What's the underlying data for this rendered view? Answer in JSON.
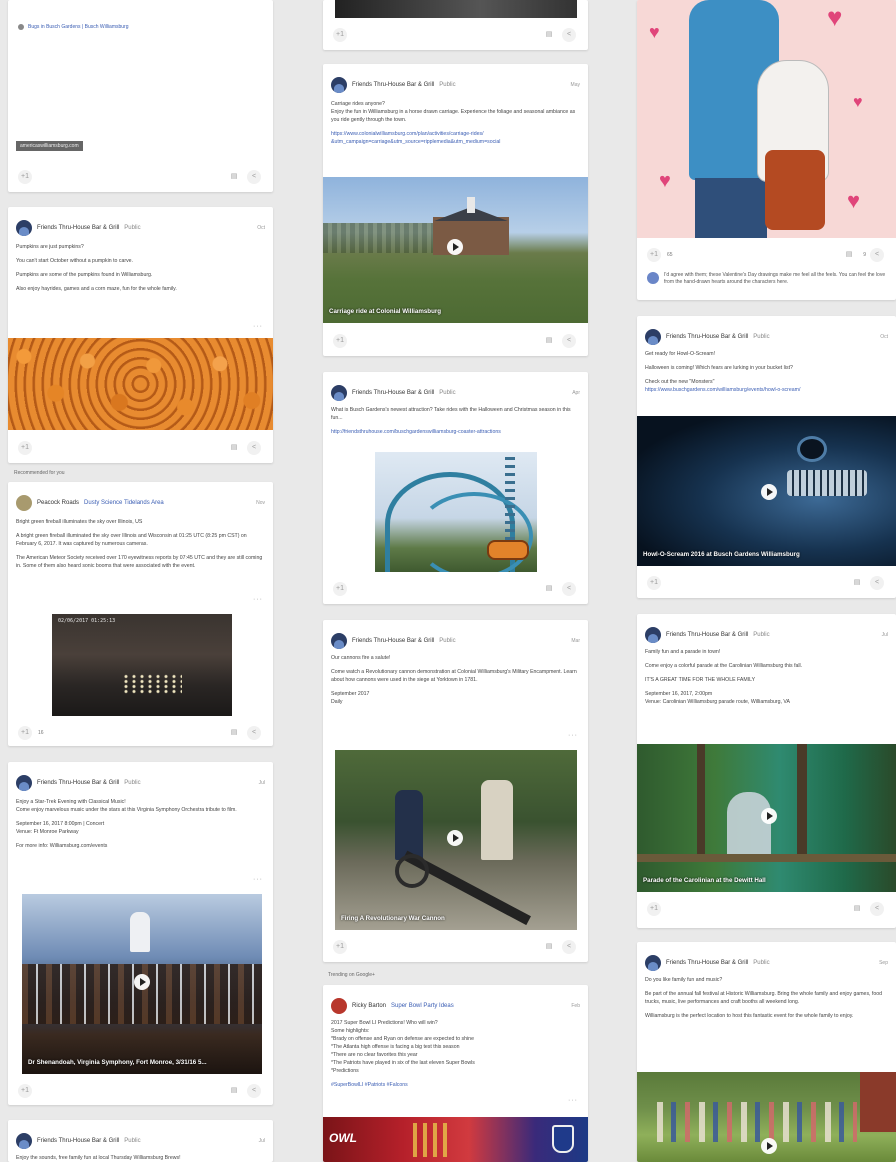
{
  "col1": {
    "card_a": {
      "link_text": "Bugs in Busch Gardens | Busch Williamsburg",
      "badge": "americaswilliamsburg.com"
    },
    "card_pumpkins": {
      "author": "Friends Thru-House Bar & Grill",
      "visibility": "Public",
      "time": "Oct",
      "p1": "Pumpkins are just pumpkins?",
      "p2": "You can't start October without a pumpkin to carve.",
      "p3": "Pumpkins are some of the pumpkins found in Williamsburg.",
      "p4": "Also enjoy hayrides, games and a corn maze, fun for the whole family."
    },
    "section_label": "Recommended for you",
    "card_fireball": {
      "author": "Peacock Roads",
      "group": "Dusty Science Tidelands Area",
      "time": "Nov",
      "p1": "Bright green fireball illuminates the sky over Illinois, US",
      "p2": "A bright green fireball illuminated the sky over Illinois and Wisconsin at 01:25 UTC (8:25 pm CST) on February 6, 2017. It was captured by numerous cameras.",
      "p3": "The American Meteor Society received over 170 eyewitness reports by 07:45 UTC and they are still coming in. Some of them also heard sonic booms that were associated with the event.",
      "timestamp": "02/06/2017  01:25:13",
      "plus_count": "16"
    },
    "card_symphony": {
      "author": "Friends Thru-House Bar & Grill",
      "visibility": "Public",
      "time": "Jul",
      "p1": "Enjoy a Star-Trek Evening with Classical Music!",
      "p2": "Come enjoy marvelous music under the stars at this Virginia Symphony Orchestra tribute to film.",
      "p3": "September 16, 2017 8:00pm | Concert",
      "p4": "Venue: Ft Monroe Parkway",
      "p5": "For more info: Williamsburg.com/events",
      "caption": "Dr Shenandoah, Virginia Symphony, Fort Monroe, 3/31/16 5..."
    },
    "card_bottom": {
      "author": "Friends Thru-House Bar & Grill",
      "visibility": "Public",
      "time": "Jul",
      "p1": "Enjoy the sounds, free family fun at local Thursday Williamsburg Brews!"
    }
  },
  "col2": {
    "card_carriage": {
      "author": "Friends Thru-House Bar & Grill",
      "visibility": "Public",
      "time": "May",
      "p1": "Carriage rides anyone?",
      "p2": "Enjoy the fun in Williamsburg in a horse drawn carriage. Experience the foliage and seasonal ambiance as you ride gently through the town.",
      "link": "https://www.colonialwilliamsburg.com/plan/activities/carriage-rides/ &utm_campaign=carriage&utm_source=ripplemedia&utm_medium=social",
      "caption": "Carriage ride at Colonial Williamsburg"
    },
    "card_coaster": {
      "author": "Friends Thru-House Bar & Grill",
      "visibility": "Public",
      "time": "Apr",
      "p1": "What is Busch Gardens's newest attraction? Take rides with the Halloween and Christmas season in this fun...",
      "link": "http://friendsthruhouse.com/buschgardenswilliamsburg-coaster-attractions"
    },
    "card_cannon": {
      "author": "Friends Thru-House Bar & Grill",
      "visibility": "Public",
      "time": "Mar",
      "p1": "Our cannons fire a salute!",
      "p2": "Come watch a Revolutionary cannon demonstration at Colonial Williamsburg's Military Encampment. Learn about how cannons were used in the siege at Yorktown in 1781.",
      "p3": "September 2017",
      "p4": "Daily",
      "caption": "Firing A Revolutionary War Cannon"
    },
    "section_label": "Trending on Google+",
    "card_super": {
      "author": "Ricky Barton",
      "group": "Super Bowl Party Ideas",
      "time": "Feb",
      "p1": "2017 Super Bowl LI Predictions! Who will win?",
      "p2": "Some highlights:",
      "p3": "*Brady on offense and Ryan on defense are expected to shine",
      "p4": "*The Atlanta high offense is facing a big test this season",
      "p5": "*There are no clear favorites this year",
      "p6": "*The Patriots have played in six of the last eleven Super Bowls",
      "p7": "*Predictions",
      "tags": "#SuperBowlLI #Patriots #Falcons"
    }
  },
  "col3": {
    "card_valentine": {
      "plus_count": "65",
      "comment_count": "9",
      "comment_text": "I'd agree with them; these Valentine's Day drawings make me feel all the feels. You can feel the love from the hand-drawn hearts around the characters here."
    },
    "card_howl": {
      "author": "Friends Thru-House Bar & Grill",
      "visibility": "Public",
      "time": "Oct",
      "p1": "Get ready for Howl-O-Scream!",
      "p2": "Halloween is coming! Which fears are lurking in your bucket list?",
      "p3": "Check out the new \"Monsters\"",
      "link": "https://www.buschgardens.com/williamsburg/events/howl-o-scream/",
      "caption": "Howl-O-Scream 2016 at Busch Gardens Williamsburg"
    },
    "card_carolinian": {
      "author": "Friends Thru-House Bar & Grill",
      "visibility": "Public",
      "time": "Jul",
      "p1": "Family fun and a parade in town!",
      "p2": "Come enjoy a colorful parade at the Carolinian Williamsburg this fall.",
      "p3": "IT'S A GREAT TIME FOR THE WHOLE FAMILY",
      "p4": "September 16, 2017, 2:00pm",
      "p5": "Venue: Carolinian Williamsburg parade route, Williamsburg, VA",
      "caption": "Parade of the Carolinian at the Dewitt Hall"
    },
    "card_festival": {
      "author": "Friends Thru-House Bar & Grill",
      "visibility": "Public",
      "time": "Sep",
      "p1": "Do you like family fun and music?",
      "p2": "Be part of the annual fall festival at Historic Williamsburg. Bring the whole family and enjoy games, food trucks, music, live performances and craft booths all weekend long.",
      "p3": "Williamsburg is the perfect location to host this fantastic event for the whole family to enjoy."
    }
  },
  "icons": {
    "plus": "+1",
    "comment": "▤",
    "share": "<",
    "play": "▶"
  }
}
